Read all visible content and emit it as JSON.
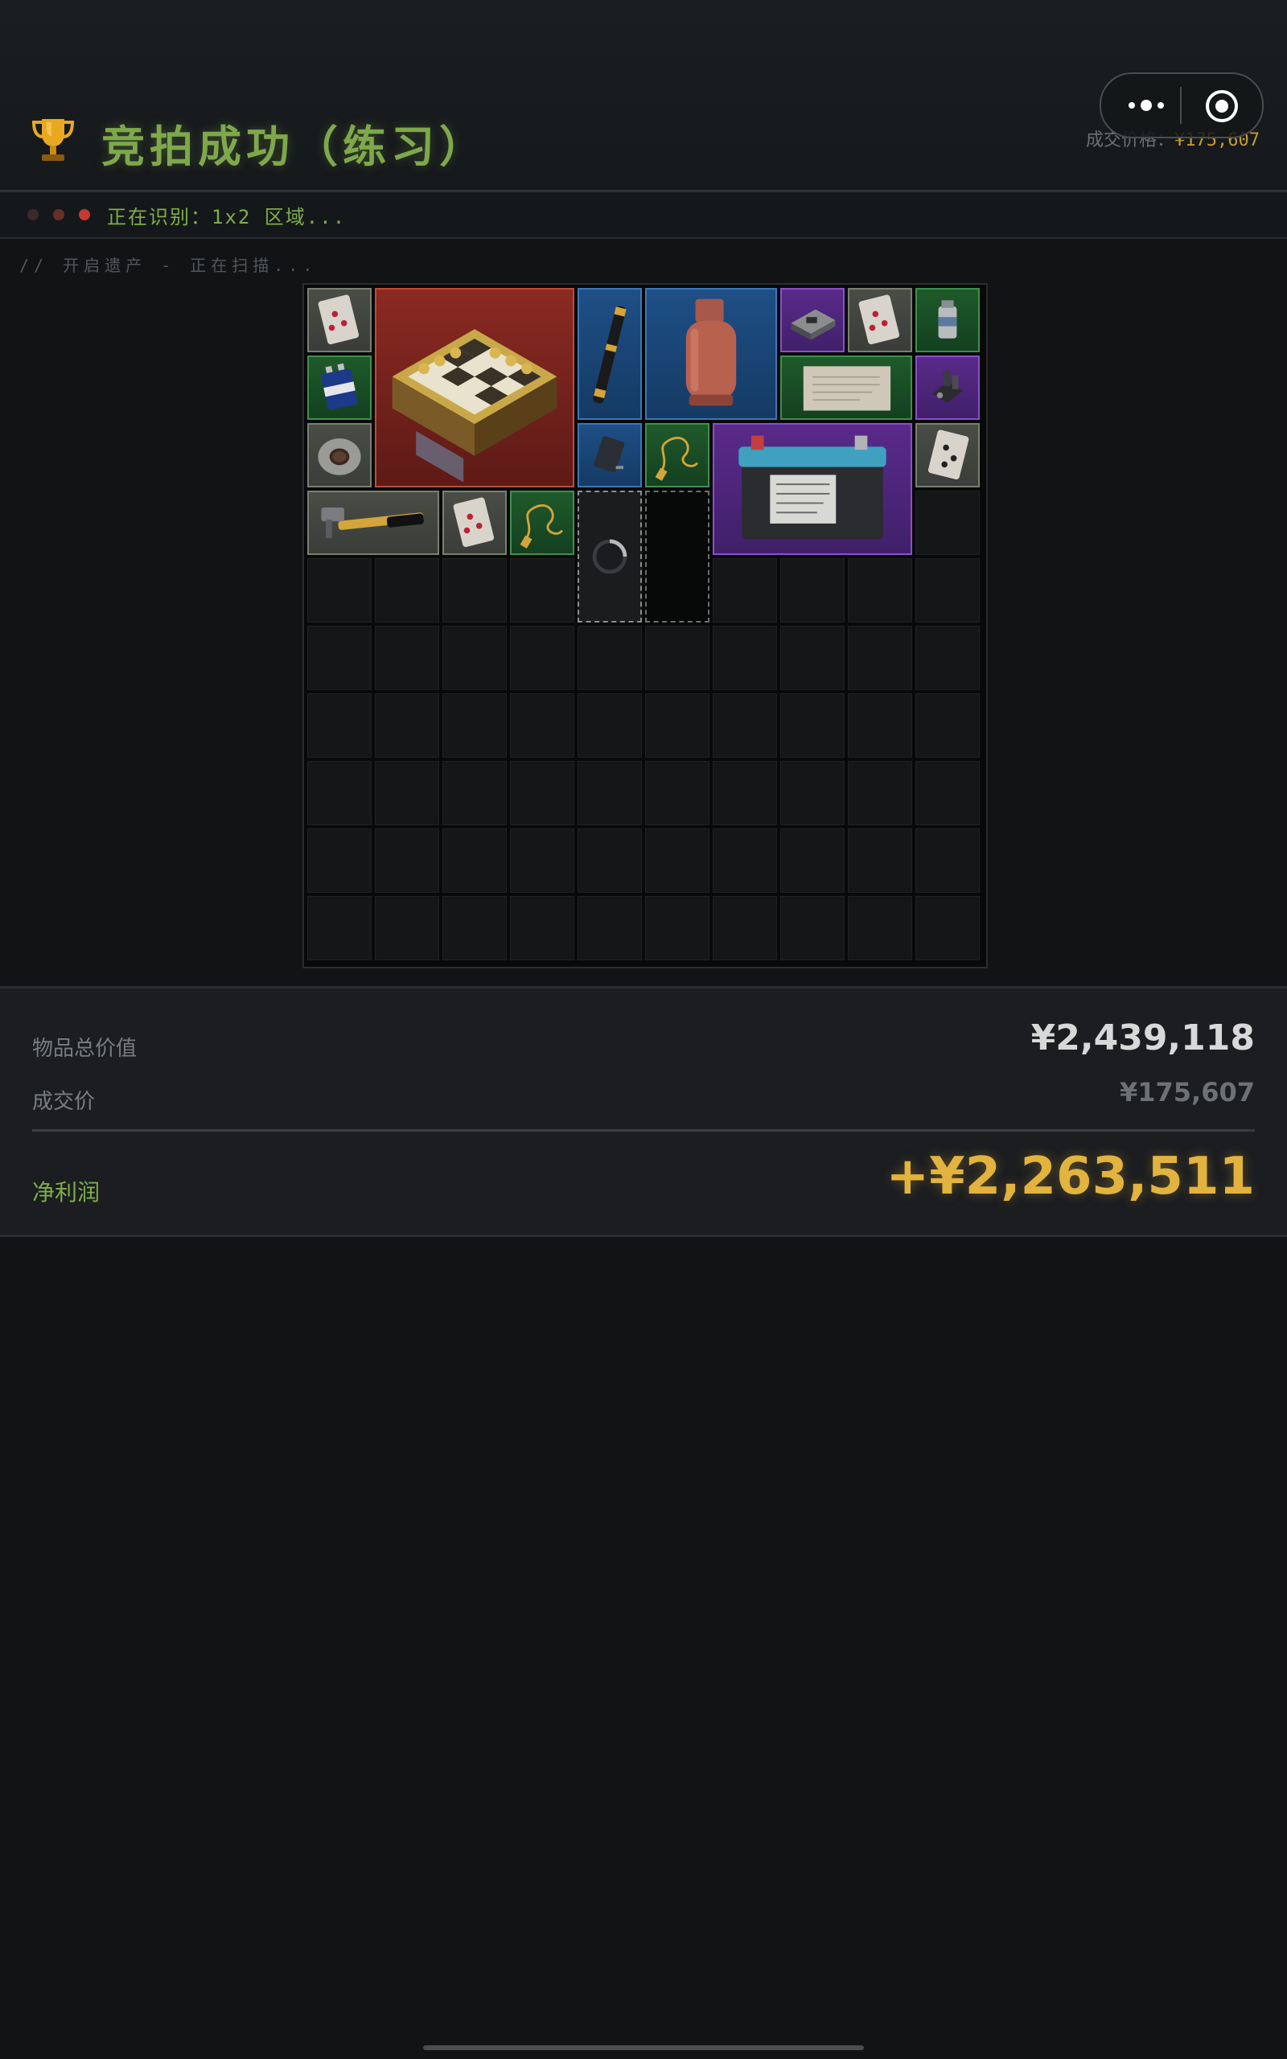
{
  "header": {
    "title": "竞拍成功（练习）",
    "price_label": "成交价格：",
    "price_value": "¥175,607"
  },
  "status": {
    "text": "正在识别：1x2 区域...",
    "dots": [
      "#3a2a2a",
      "#6a2e2a",
      "#c23a32"
    ]
  },
  "scan_text": "// 开启遗产 - 正在扫描...",
  "inventory": {
    "rows": 10,
    "cols": 10,
    "items": [
      {
        "name": "playing-card",
        "rarity": "gray"
      },
      {
        "name": "chess-set",
        "rarity": "red"
      },
      {
        "name": "telescope",
        "rarity": "blue"
      },
      {
        "name": "gas-canister",
        "rarity": "blue"
      },
      {
        "name": "circuit-module",
        "rarity": "purple"
      },
      {
        "name": "playing-card",
        "rarity": "gray"
      },
      {
        "name": "canister-small",
        "rarity": "green"
      },
      {
        "name": "battery-9v",
        "rarity": "green"
      },
      {
        "name": "old-document",
        "rarity": "green"
      },
      {
        "name": "electronic-part",
        "rarity": "purple"
      },
      {
        "name": "duct-tape",
        "rarity": "gray"
      },
      {
        "name": "hard-drive",
        "rarity": "blue"
      },
      {
        "name": "gold-chain",
        "rarity": "green"
      },
      {
        "name": "car-battery",
        "rarity": "purple"
      },
      {
        "name": "playing-card-spade",
        "rarity": "gray"
      },
      {
        "name": "hammer",
        "rarity": "gray"
      },
      {
        "name": "playing-card",
        "rarity": "gray"
      },
      {
        "name": "gold-chain",
        "rarity": "green"
      }
    ]
  },
  "summary": {
    "total_label": "物品总价值",
    "total_value": "¥2,439,118",
    "deal_label": "成交价",
    "deal_value": "¥175,607",
    "profit_label": "净利润",
    "profit_value": "+¥2,263,511"
  },
  "colors": {
    "accent_green": "#7fae4b",
    "gold": "#e2b33e",
    "rarity_gray": "#7b7f72",
    "rarity_green": "#3f8f4e",
    "rarity_blue": "#3c77b8",
    "rarity_purple": "#8a50c8",
    "rarity_red": "#c04a3a"
  }
}
